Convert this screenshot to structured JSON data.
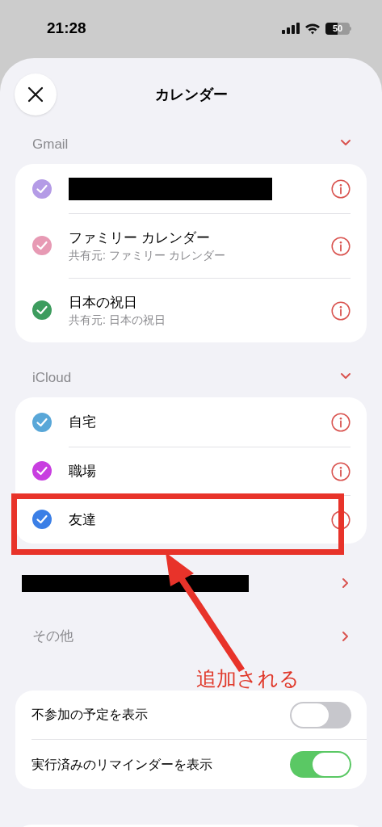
{
  "status_bar": {
    "time": "21:28",
    "battery": "50"
  },
  "header": {
    "title": "カレンダー"
  },
  "sections": [
    {
      "name": "Gmail",
      "expanded": true,
      "calendars": [
        {
          "kind": "redacted",
          "color": "#b49be6",
          "checked": true
        },
        {
          "kind": "calendar",
          "name": "ファミリー カレンダー",
          "subtitle": "共有元: ファミリー カレンダー",
          "color": "#e79ab4",
          "checked": true
        },
        {
          "kind": "calendar",
          "name": "日本の祝日",
          "subtitle": "共有元: 日本の祝日",
          "color": "#3d9c5e",
          "checked": true
        }
      ]
    },
    {
      "name": "iCloud",
      "expanded": true,
      "calendars": [
        {
          "kind": "calendar",
          "name": "自宅",
          "color": "#59a7d8",
          "checked": true
        },
        {
          "kind": "calendar",
          "name": "職場",
          "color": "#c83ee0",
          "checked": true
        },
        {
          "kind": "calendar",
          "name": "友達",
          "color": "#3b7fe6",
          "checked": true
        }
      ]
    }
  ],
  "links": [
    {
      "kind": "redacted"
    },
    {
      "kind": "link",
      "label": "その他"
    }
  ],
  "toggles": [
    {
      "label": "不参加の予定を表示",
      "on": false
    },
    {
      "label": "実行済みのリマインダーを表示",
      "on": true
    }
  ],
  "annotation": {
    "text": "追加される"
  }
}
